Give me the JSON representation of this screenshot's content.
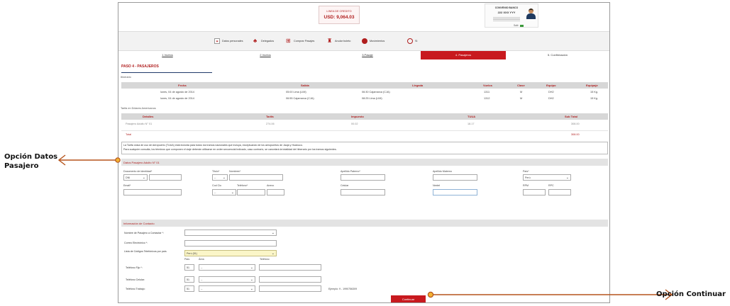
{
  "header": {
    "credit_label": "LINEA DE CREDITO",
    "credit_value": "USD: 9,064.03",
    "user_name": "CONVENIO BANCO",
    "user_code": "222 XXX YYY",
    "logout_label": "Salir"
  },
  "menu": {
    "items": [
      {
        "label": "Datos personales",
        "icon": "person-card-icon"
      },
      {
        "label": "Delegados",
        "icon": "people-icon"
      },
      {
        "label": "Comprar Pasajes",
        "icon": "cart-icon"
      },
      {
        "label": "Anular boleto",
        "icon": "trash-icon"
      },
      {
        "label": "Movimientos",
        "icon": "circle-icon"
      },
      {
        "label": "Si",
        "icon": "power-icon"
      }
    ]
  },
  "steps": [
    "1.Vuelos",
    "2.Vuelos",
    "3.Pasaje",
    "4. Pasajeros",
    "5. Confirmación"
  ],
  "page": {
    "title": "PASO 4 - PASAJEROS",
    "itinerario_label": "Itinerario"
  },
  "itinerary": {
    "headers": [
      "Fecha",
      "Salida",
      "Llegada",
      "Vuelos",
      "Clase",
      "Equipo",
      "Equipaje"
    ],
    "rows": [
      [
        "lunes, 04 de agosto de 2014",
        "05:00 Lima (LIM)",
        "06:30 Cajamarca (CJA)",
        "1311",
        "M",
        "DH2",
        "15 Kg."
      ],
      [
        "lunes, 04 de agosto de 2014",
        "06:55 Cajamarca (CJA)",
        "08:25 Lima (LIM)",
        "1312",
        "M",
        "DH2",
        "15 Kg."
      ]
    ]
  },
  "fare": {
    "label": "Tarifa en Dólares Americanos",
    "headers": [
      "Detalles",
      "Tarifa",
      "Impuesto",
      "TUUA",
      "Sub Total"
    ],
    "row": [
      "Pasajero Adulto N° 01",
      "274.06",
      "00.02",
      "18.17",
      "308.00"
    ],
    "total_label": "Total",
    "total_value": "308.00"
  },
  "notice": {
    "line1": "La Tarifa única de uso de Aeropuerto (TUUA) está incluida para todos los tramos nacionales que incluya, exceptuando de los aeropuertos de Jauja y Huánuco.",
    "line2": "Para cualquier consulta, los términos que componen el viaje deberán utilizarse en orden secuencial indicado, caso contrario, se cancelará la totalidad del itinerario por los tramos siguientes."
  },
  "passenger": {
    "section_title": "Datos Pasajero Adulto N° 01",
    "doc_label": "Documento de identidad*",
    "doc_type": "DNI",
    "titulo_label": "Título*",
    "titulo_value": "--",
    "nombres_label": "Nombres*",
    "apellido_paterno_label": "Apellido Paterno*",
    "apellido_materno_label": "Apellido Materno",
    "pais_label": "País*",
    "pais_value": "Perú",
    "email_label": "Email*",
    "codciu_label": "Cod Ciu",
    "codciu_value": "--",
    "celular_label": "Celular",
    "anexo_label": "Anexo",
    "nextel_label": "Nextel",
    "rpm_label": "RPM",
    "rpc_label": "RPC",
    "telefono_label": "Teléfono*"
  },
  "contact": {
    "section_title": "Información de Contacto",
    "nombre_label": "Nombre de Pasajero a Contactar *:",
    "correo_label": "Correo Electrónico *:",
    "lista_label": "Lista de Códigos Telefónicos por país",
    "lista_value": "Perú (51)",
    "col_pais": "País",
    "col_area": "Área",
    "col_telefono": "Teléfono",
    "fijo_label": "Teléfono Fijo *:",
    "celular_label": "Teléfono Celular:",
    "trabajo_label": "Teléfono Trabajo:",
    "code": "51",
    "area_placeholder": "--",
    "ejemplo": "Ejemplo: 9 - 1990756309"
  },
  "buttons": {
    "continuar": "Continuar"
  },
  "annotations": {
    "left_line1": "Opción Datos",
    "left_line2": "Pasajero",
    "right": "Opción Continuar",
    "color": "#b5541c"
  }
}
